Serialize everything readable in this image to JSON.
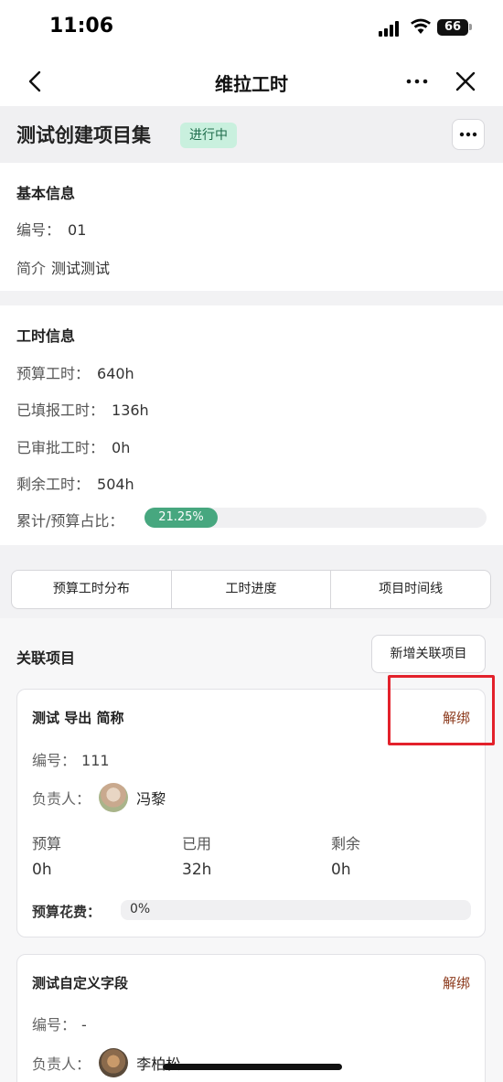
{
  "status_bar": {
    "time": "11:06",
    "battery": "66"
  },
  "nav": {
    "title": "维拉工时"
  },
  "project": {
    "title": "测试创建项目集",
    "status": "进行中"
  },
  "basic_info": {
    "title": "基本信息",
    "code_label": "编号：",
    "code_value": "01",
    "intro_label": "简介",
    "intro_value": "测试测试"
  },
  "hours_info": {
    "title": "工时信息",
    "budget_label": "预算工时：",
    "budget_value": "640h",
    "filled_label": "已填报工时：",
    "filled_value": "136h",
    "approved_label": "已审批工时：",
    "approved_value": "0h",
    "remaining_label": "剩余工时：",
    "remaining_value": "504h",
    "ratio_label": "累计/预算占比：",
    "ratio_value": "21.25%",
    "ratio_fraction": 0.2125
  },
  "tabs": [
    "预算工时分布",
    "工时进度",
    "项目时间线"
  ],
  "related": {
    "title": "关联项目",
    "add_button": "新增关联项目",
    "projects": [
      {
        "name": "测试 导出 简称",
        "unbind": "解绑",
        "code_label": "编号：",
        "code_value": "111",
        "owner_label": "负责人：",
        "owner_name": "冯黎",
        "budget_label": "预算",
        "budget_value": "0h",
        "used_label": "已用",
        "used_value": "32h",
        "remaining_label": "剩余",
        "remaining_value": "0h",
        "cost_label": "预算花费：",
        "cost_value": "0%"
      },
      {
        "name": "测试自定义字段",
        "unbind": "解绑",
        "code_label": "编号：",
        "code_value": "-",
        "owner_label": "负责人：",
        "owner_name": "李柏松"
      }
    ]
  },
  "colors": {
    "accent_green": "#47a77f",
    "badge_bg": "#c9f0de",
    "unbind_red": "#8c3a1c",
    "highlight": "#e3212b"
  },
  "icons": [
    "back-icon",
    "more-icon",
    "close-icon",
    "ellipsis-icon"
  ]
}
